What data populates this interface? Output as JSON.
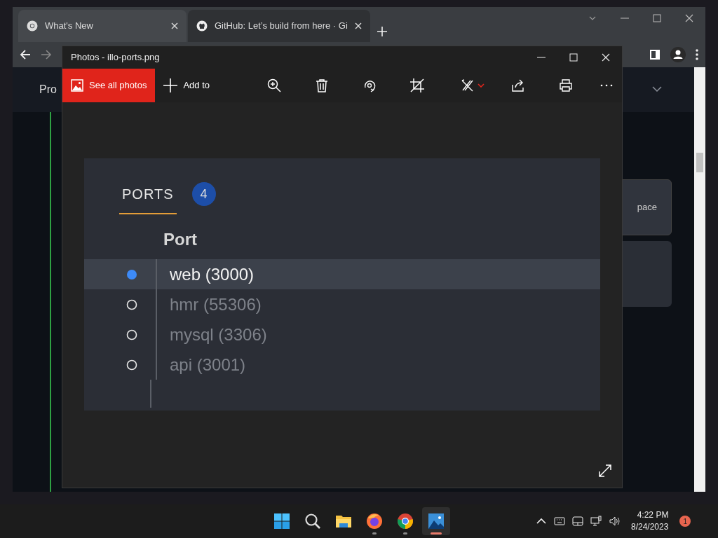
{
  "browser": {
    "tabs": [
      {
        "title": "What's New",
        "selected": true
      },
      {
        "title": "GitHub: Let’s build from here · Gi",
        "selected": false
      }
    ],
    "nav_text": "Pro",
    "card_text": "pace"
  },
  "photos": {
    "title": "Photos - illo-ports.png",
    "see_all_label": "See all photos",
    "add_to_label": "Add to",
    "image": {
      "tab_label": "PORTS",
      "count": "4",
      "column": "Port",
      "ports": [
        {
          "label": "web (3000)",
          "selected": true
        },
        {
          "label": "hmr (55306)",
          "selected": false
        },
        {
          "label": "mysql (3306)",
          "selected": false
        },
        {
          "label": "api (3001)",
          "selected": false
        }
      ]
    }
  },
  "taskbar": {
    "apps": [
      {
        "kind": "start",
        "running": false,
        "selected": false
      },
      {
        "kind": "search",
        "running": false,
        "selected": false
      },
      {
        "kind": "explorer",
        "running": false,
        "selected": false
      },
      {
        "kind": "firefox",
        "running": true,
        "selected": false
      },
      {
        "kind": "chrome",
        "running": true,
        "selected": false
      },
      {
        "kind": "photos",
        "running": true,
        "selected": true
      }
    ],
    "time": "4:22 PM",
    "date": "8/24/2023",
    "notifications": "1"
  }
}
